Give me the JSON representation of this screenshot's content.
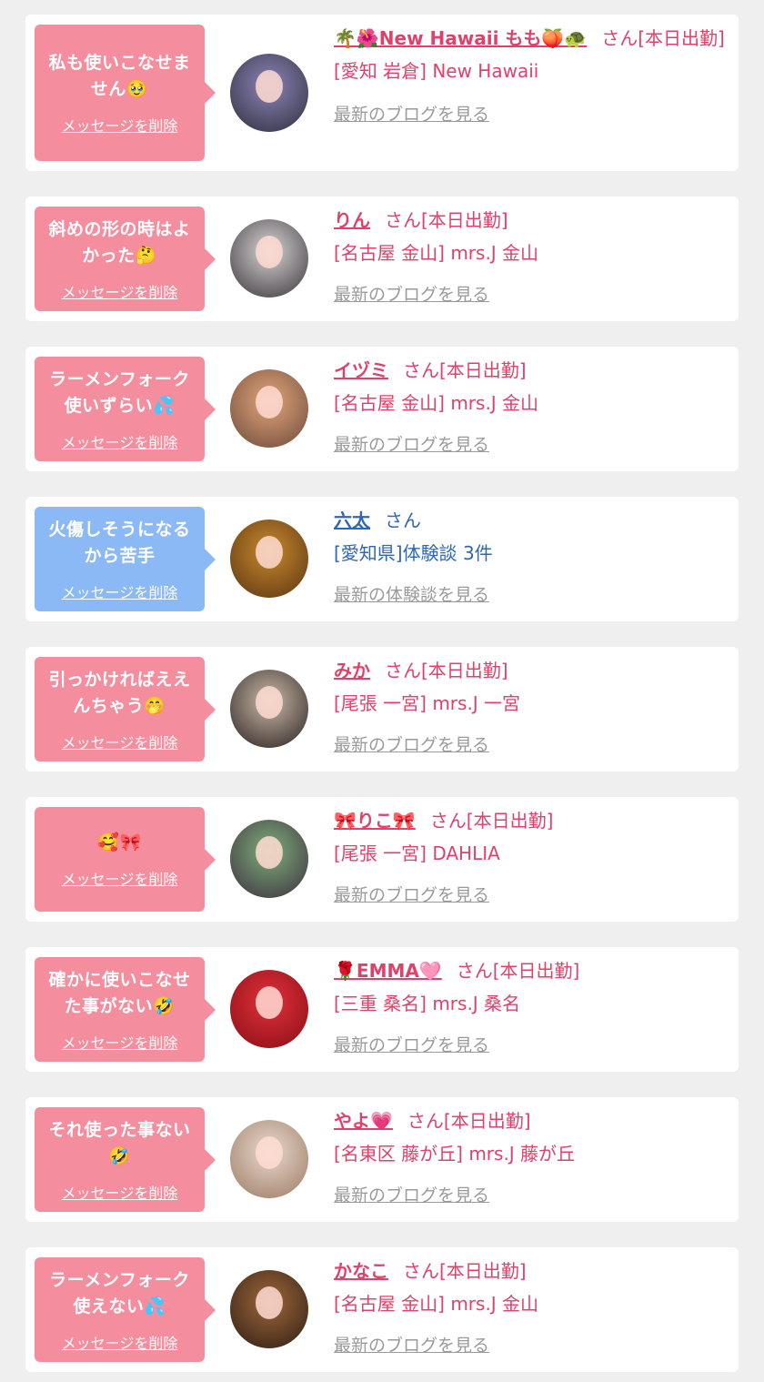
{
  "delete_label": "メッセージを削除",
  "items": [
    {
      "message": "私も使いこなせません🥹",
      "name": "🌴🌺New Hawaii もも🍑🐢",
      "suffix": "さん[本日出勤]",
      "shop": "[愛知 岩倉] New Hawaii",
      "link": "最新のブログを見る",
      "bubble_color": "#f48e9e",
      "avatar_colors": [
        "#8d84b8",
        "#2d2f3c"
      ]
    },
    {
      "message": "斜めの形の時はよかった🤔",
      "name": "りん",
      "suffix": "さん[本日出勤]",
      "shop": "[名古屋 金山] mrs.J 金山",
      "link": "最新のブログを見る",
      "bubble_color": "#f48e9e",
      "avatar_colors": [
        "#d8d4d6",
        "#3a3538"
      ]
    },
    {
      "message": "ラーメンフォーク使いずらい💦",
      "name": "イヅミ",
      "suffix": "さん[本日出勤]",
      "shop": "[名古屋 金山] mrs.J 金山",
      "link": "最新のブログを見る",
      "bubble_color": "#f48e9e",
      "avatar_colors": [
        "#e3a57c",
        "#6c4a3a"
      ]
    },
    {
      "message": "火傷しそうになるから苦手",
      "name": "六太",
      "suffix": "さん",
      "shop": "[愛知県]体験談 3件",
      "link": "最新の体験談を見る",
      "bubble_color": "#8ab9f5",
      "avatar_colors": [
        "#c8892e",
        "#5a3412"
      ]
    },
    {
      "message": "引っかければええんちゃう🤭",
      "name": "みか",
      "suffix": "さん[本日出勤]",
      "shop": "[尾張 一宮] mrs.J 一宮",
      "link": "最新のブログを見る",
      "bubble_color": "#f48e9e",
      "avatar_colors": [
        "#c9b9a8",
        "#2a2220"
      ]
    },
    {
      "message": "🥰🎀",
      "name": "🎀りこ🎀",
      "suffix": "さん[本日出勤]",
      "shop": "[尾張 一宮] DAHLIA",
      "link": "最新のブログを見る",
      "bubble_color": "#f48e9e",
      "avatar_colors": [
        "#7fae7a",
        "#3b2f3f"
      ]
    },
    {
      "message": "確かに使いこなせた事がない🤣",
      "name": "🌹EMMA🩷",
      "suffix": "さん[本日出勤]",
      "shop": "[三重 桑名] mrs.J 桑名",
      "link": "最新のブログを見る",
      "bubble_color": "#f48e9e",
      "avatar_colors": [
        "#e0323c",
        "#8a0d14"
      ]
    },
    {
      "message": "それ使った事ない🤣",
      "name": "やよ💗",
      "suffix": "さん[本日出勤]",
      "shop": "[名東区 藤が丘] mrs.J 藤が丘",
      "link": "最新のブログを見る",
      "bubble_color": "#f48e9e",
      "avatar_colors": [
        "#e8d8ce",
        "#9c7b62"
      ]
    },
    {
      "message": "ラーメンフォーク使えない💦",
      "name": "かなこ",
      "suffix": "さん[本日出勤]",
      "shop": "[名古屋 金山] mrs.J 金山",
      "link": "最新のブログを見る",
      "bubble_color": "#f48e9e",
      "avatar_colors": [
        "#a0683a",
        "#2c1d14"
      ]
    }
  ]
}
